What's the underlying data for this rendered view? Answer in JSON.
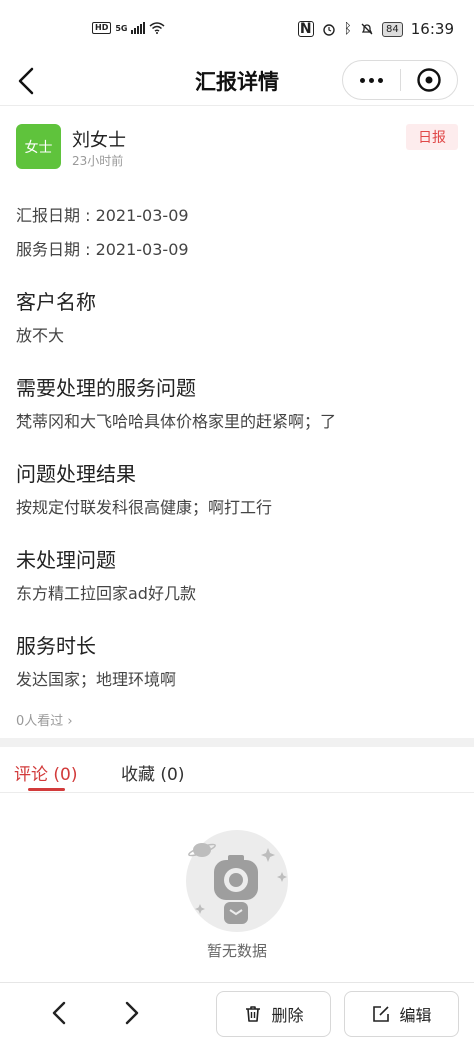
{
  "status_bar": {
    "hd": "HD",
    "network": "5G",
    "battery": "84",
    "time": "16:39"
  },
  "nav": {
    "title": "汇报详情"
  },
  "author": {
    "avatar_text": "女士",
    "name": "刘女士",
    "time_ago": "23小时前",
    "report_type": "日报"
  },
  "meta": {
    "report_date": "汇报日期 : 2021-03-09",
    "service_date": "服务日期 : 2021-03-09"
  },
  "sections": [
    {
      "title": "客户名称",
      "value": "放不大"
    },
    {
      "title": "需要处理的服务问题",
      "value": "梵蒂冈和大飞哈哈具体价格家里的赶紧啊；了"
    },
    {
      "title": "问题处理结果",
      "value": "按规定付联发科很高健康；啊打工行"
    },
    {
      "title": "未处理问题",
      "value": "东方精工拉回家ad好几款"
    },
    {
      "title": "服务时长",
      "value": "发达国家；地理环境啊"
    }
  ],
  "viewers": "0人看过 ›",
  "tabs": {
    "comments": "评论 (0)",
    "favorites": "收藏 (0)"
  },
  "empty_text": "暂无数据",
  "bottom": {
    "delete_label": "删除",
    "edit_label": "编辑"
  },
  "colors": {
    "accent": "#d23b3b",
    "avatar_bg": "#5fc33c",
    "badge_bg": "#fdeced",
    "badge_text": "#e04848"
  }
}
